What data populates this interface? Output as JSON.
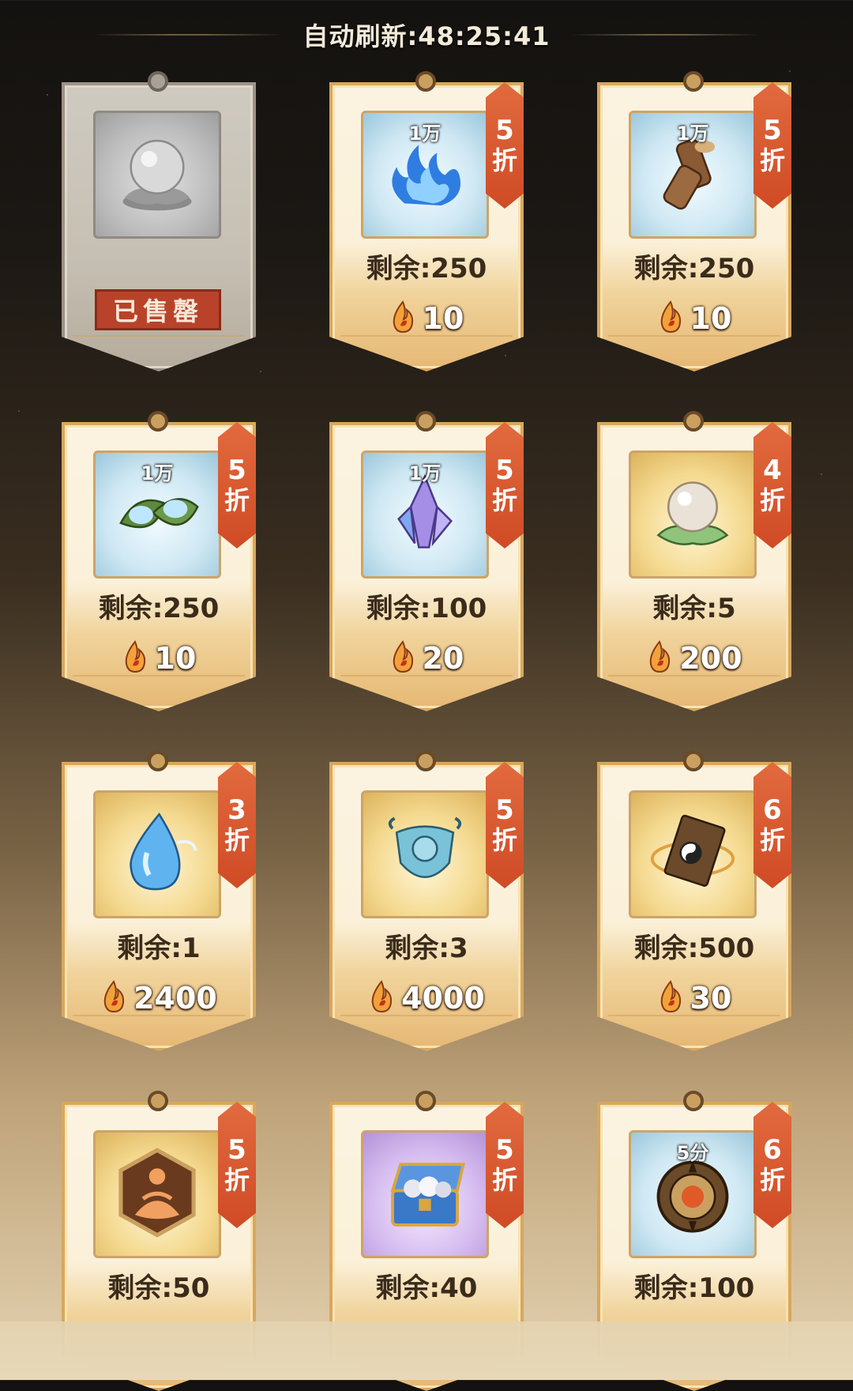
{
  "header": {
    "refresh_timer": "自动刷新:48:25:41"
  },
  "items": [
    {
      "icon": "crystal-ball-icon",
      "theme": "grey",
      "sold_out": true,
      "sold_out_label": "已售罄"
    },
    {
      "icon": "blue-flame-icon",
      "theme": "blue",
      "qty": "1万",
      "discount_num": "5",
      "discount_unit": "折",
      "remaining": "剩余:250",
      "price": "10"
    },
    {
      "icon": "wood-logs-icon",
      "theme": "blue",
      "qty": "1万",
      "discount_num": "5",
      "discount_unit": "折",
      "remaining": "剩余:250",
      "price": "10"
    },
    {
      "icon": "leaf-dew-icon",
      "theme": "blue",
      "qty": "1万",
      "discount_num": "5",
      "discount_unit": "折",
      "remaining": "剩余:250",
      "price": "10"
    },
    {
      "icon": "crystal-icon",
      "theme": "blue",
      "qty": "1万",
      "discount_num": "5",
      "discount_unit": "折",
      "remaining": "剩余:100",
      "price": "20"
    },
    {
      "icon": "crystal-ball-icon",
      "theme": "gold",
      "discount_num": "4",
      "discount_unit": "折",
      "remaining": "剩余:5",
      "price": "200"
    },
    {
      "icon": "water-drop-icon",
      "theme": "gold",
      "discount_num": "3",
      "discount_unit": "折",
      "remaining": "剩余:1",
      "price": "2400"
    },
    {
      "icon": "jade-token-icon",
      "theme": "gold",
      "discount_num": "5",
      "discount_unit": "折",
      "remaining": "剩余:3",
      "price": "4000"
    },
    {
      "icon": "scripture-book-icon",
      "theme": "gold",
      "discount_num": "6",
      "discount_unit": "折",
      "remaining": "剩余:500",
      "price": "30"
    },
    {
      "icon": "meditation-badge-icon",
      "theme": "gold",
      "discount_num": "5",
      "discount_unit": "折",
      "remaining": "剩余:50",
      "price": ""
    },
    {
      "icon": "treasure-chest-icon",
      "theme": "purple",
      "discount_num": "5",
      "discount_unit": "折",
      "remaining": "剩余:40",
      "price": ""
    },
    {
      "icon": "compass-disc-icon",
      "theme": "blue",
      "qty": "5分",
      "discount_num": "6",
      "discount_unit": "折",
      "remaining": "剩余:100",
      "price": ""
    }
  ],
  "colors": {
    "ribbon": "#cf4b25",
    "card_border": "#d9a75c",
    "price_text": "#ffffff"
  }
}
